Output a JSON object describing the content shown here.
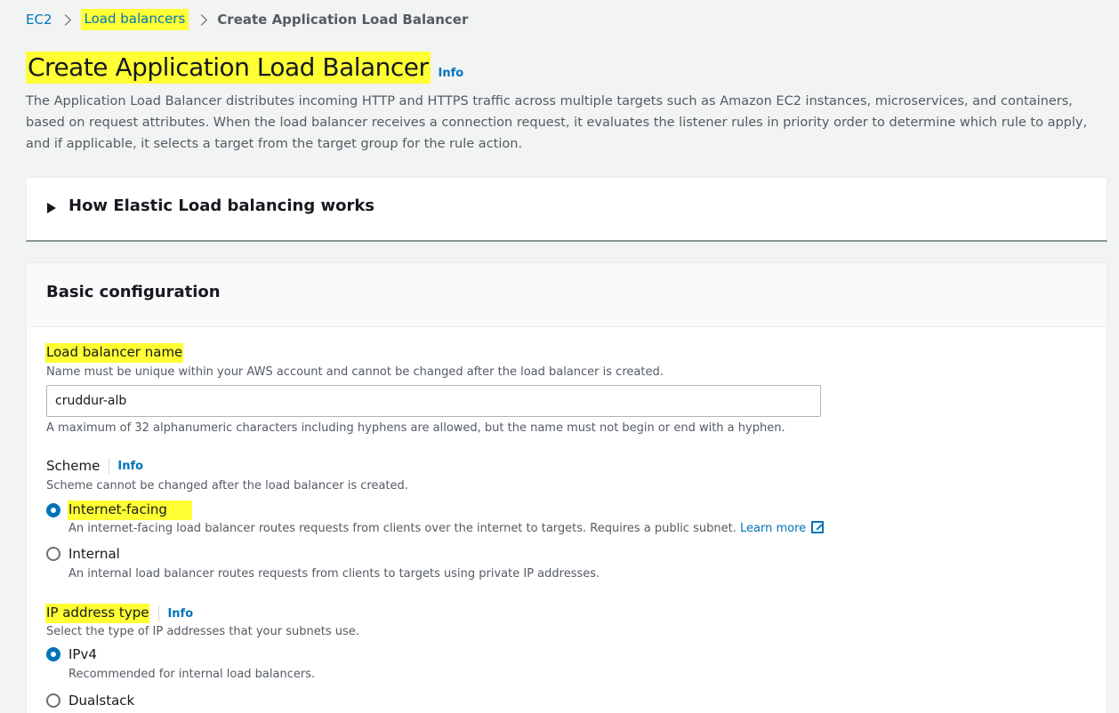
{
  "breadcrumb": {
    "items": [
      {
        "label": "EC2"
      },
      {
        "label": "Load balancers"
      },
      {
        "label": "Create Application Load Balancer"
      }
    ]
  },
  "header": {
    "title": "Create Application Load Balancer",
    "info": "Info",
    "description": "The Application Load Balancer distributes incoming HTTP and HTTPS traffic across multiple targets such as Amazon EC2 instances, microservices, and containers, based on request attributes. When the load balancer receives a connection request, it evaluates the listener rules in priority order to determine which rule to apply, and if applicable, it selects a target from the target group for the rule action."
  },
  "expander": {
    "title": "How Elastic Load balancing works"
  },
  "basic_config": {
    "title": "Basic configuration",
    "name_field": {
      "label": "Load balancer name",
      "description": "Name must be unique within your AWS account and cannot be changed after the load balancer is created.",
      "value": "cruddur-alb",
      "constraint": "A maximum of 32 alphanumeric characters including hyphens are allowed, but the name must not begin or end with a hyphen."
    },
    "scheme": {
      "label": "Scheme",
      "info": "Info",
      "description": "Scheme cannot be changed after the load balancer is created.",
      "options": [
        {
          "label": "Internet-facing",
          "description": "An internet-facing load balancer routes requests from clients over the internet to targets. Requires a public subnet.",
          "link": "Learn more",
          "selected": true
        },
        {
          "label": "Internal",
          "description": "An internal load balancer routes requests from clients to targets using private IP addresses.",
          "selected": false
        }
      ]
    },
    "ip_type": {
      "label": "IP address type",
      "info": "Info",
      "description": "Select the type of IP addresses that your subnets use.",
      "options": [
        {
          "label": "IPv4",
          "description": "Recommended for internal load balancers.",
          "selected": true
        },
        {
          "label": "Dualstack",
          "selected": false
        }
      ]
    }
  },
  "colors": {
    "highlight": "#ffff33",
    "link": "#0073bb",
    "text": "#16191f",
    "muted": "#545b64"
  }
}
